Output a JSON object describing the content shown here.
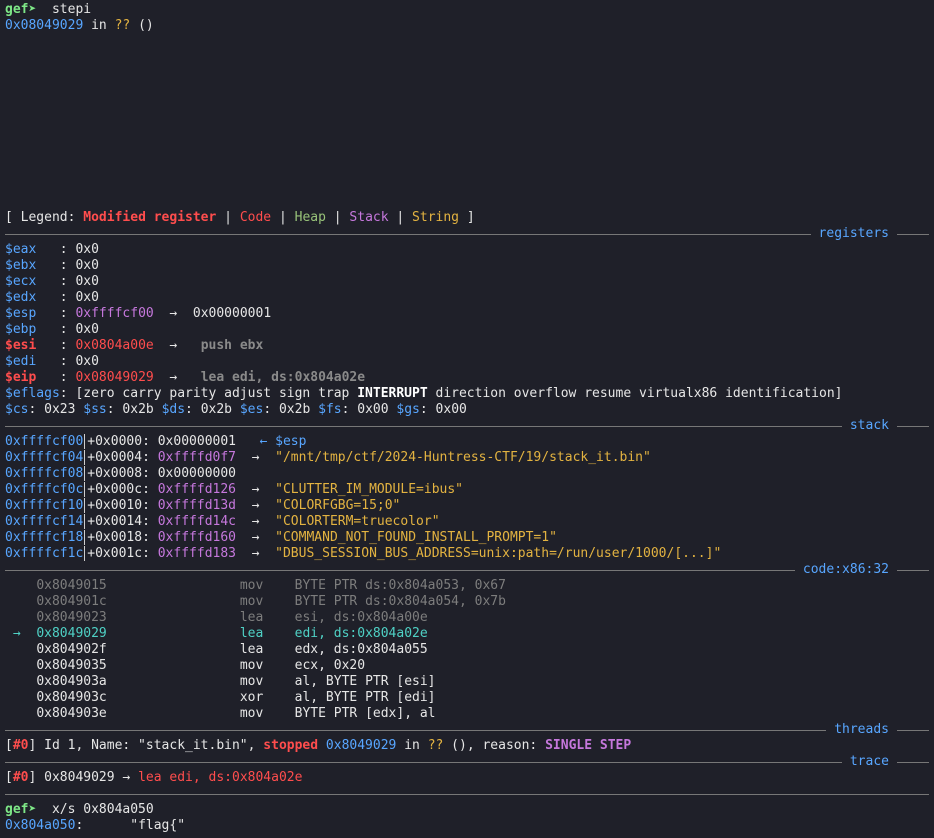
{
  "cmd1": {
    "prompt": "gef➤",
    "command": "stepi"
  },
  "loc": {
    "addr": "0x08049029",
    "in": "in",
    "fn": "??",
    "parens": "()"
  },
  "legend": {
    "open": "[ Legend: ",
    "modified": "Modified register",
    "sep": " | ",
    "code": "Code",
    "heap": "Heap",
    "stack": "Stack",
    "string": "String",
    "close": " ]"
  },
  "sections": {
    "registers": "registers",
    "stack": "stack",
    "code": "code:x86:32",
    "threads": "threads",
    "trace": "trace"
  },
  "registers": [
    {
      "name": "$eax",
      "sep": "   : ",
      "value": "0x0"
    },
    {
      "name": "$ebx",
      "sep": "   : ",
      "value": "0x0"
    },
    {
      "name": "$ecx",
      "sep": "   : ",
      "value": "0x0"
    },
    {
      "name": "$edx",
      "sep": "   : ",
      "value": "0x0"
    },
    {
      "name": "$esp",
      "sep": "   : ",
      "value": "0xffffcf00",
      "arrow": "  →  ",
      "target": "0x00000001"
    },
    {
      "name": "$ebp",
      "sep": "   : ",
      "value": "0x0"
    },
    {
      "name": "$esi",
      "sep": "   : ",
      "value": "0x0804a00e",
      "arrow": "  →  ",
      "target": " push ebx"
    },
    {
      "name": "$edi",
      "sep": "   : ",
      "value": "0x0"
    },
    {
      "name": "$eip",
      "sep": "   : ",
      "value": "0x08049029",
      "arrow": "  →  ",
      "target": " lea edi, ds:0x804a02e"
    }
  ],
  "eflags": {
    "name": "$eflags",
    "pre": ": [zero carry parity adjust sign trap ",
    "bold": "INTERRUPT",
    "post": " direction overflow resume virtualx86 identification]"
  },
  "segs": [
    {
      "name": "$cs",
      "value": ": 0x23 "
    },
    {
      "name": "$ss",
      "value": ": 0x2b "
    },
    {
      "name": "$ds",
      "value": ": 0x2b "
    },
    {
      "name": "$es",
      "value": ": 0x2b "
    },
    {
      "name": "$fs",
      "value": ": 0x00 "
    },
    {
      "name": "$gs",
      "value": ": 0x00"
    }
  ],
  "stack": [
    {
      "addr": "0xffffcf00",
      "off": "+0x0000: ",
      "val": "0x00000001",
      "arrow": "   ← ",
      "note": "$esp"
    },
    {
      "addr": "0xffffcf04",
      "off": "+0x0004: ",
      "val": "0xffffd0f7",
      "arrow": "  →  ",
      "note": "\"/mnt/tmp/ctf/2024-Huntress-CTF/19/stack_it.bin\""
    },
    {
      "addr": "0xffffcf08",
      "off": "+0x0008: ",
      "val": "0x00000000",
      "arrow": "",
      "note": ""
    },
    {
      "addr": "0xffffcf0c",
      "off": "+0x000c: ",
      "val": "0xffffd126",
      "arrow": "  →  ",
      "note": "\"CLUTTER_IM_MODULE=ibus\""
    },
    {
      "addr": "0xffffcf10",
      "off": "+0x0010: ",
      "val": "0xffffd13d",
      "arrow": "  →  ",
      "note": "\"COLORFGBG=15;0\""
    },
    {
      "addr": "0xffffcf14",
      "off": "+0x0014: ",
      "val": "0xffffd14c",
      "arrow": "  →  ",
      "note": "\"COLORTERM=truecolor\""
    },
    {
      "addr": "0xffffcf18",
      "off": "+0x0018: ",
      "val": "0xffffd160",
      "arrow": "  →  ",
      "note": "\"COMMAND_NOT_FOUND_INSTALL_PROMPT=1\""
    },
    {
      "addr": "0xffffcf1c",
      "off": "+0x001c: ",
      "val": "0xffffd183",
      "arrow": "  →  ",
      "note": "\"DBUS_SESSION_BUS_ADDRESS=unix:path=/run/user/1000/[...]\""
    }
  ],
  "code": [
    {
      "mark": "    ",
      "addr": "0x8049015",
      "op": "mov",
      "args": "BYTE PTR ds:0x804a053, 0x67",
      "state": "past"
    },
    {
      "mark": "    ",
      "addr": "0x804901c",
      "op": "mov",
      "args": "BYTE PTR ds:0x804a054, 0x7b",
      "state": "past"
    },
    {
      "mark": "    ",
      "addr": "0x8049023",
      "op": "lea",
      "args": "esi, ds:0x804a00e",
      "state": "past"
    },
    {
      "mark": " →  ",
      "addr": "0x8049029",
      "op": "lea",
      "args": "edi, ds:0x804a02e",
      "state": "current"
    },
    {
      "mark": "    ",
      "addr": "0x804902f",
      "op": "lea",
      "args": "edx, ds:0x804a055",
      "state": "next"
    },
    {
      "mark": "    ",
      "addr": "0x8049035",
      "op": "mov",
      "args": "ecx, 0x20",
      "state": "next"
    },
    {
      "mark": "    ",
      "addr": "0x804903a",
      "op": "mov",
      "args": "al, BYTE PTR [esi]",
      "state": "next"
    },
    {
      "mark": "    ",
      "addr": "0x804903c",
      "op": "xor",
      "args": "al, BYTE PTR [edi]",
      "state": "next"
    },
    {
      "mark": "    ",
      "addr": "0x804903e",
      "op": "mov",
      "args": "BYTE PTR [edx], al",
      "state": "next"
    }
  ],
  "thread": {
    "open": "[",
    "idx": "#0",
    "close": "] ",
    "text": "Id 1, Name: \"stack_it.bin\", ",
    "status": "stopped",
    "addr": "0x8049029",
    "in": " in ",
    "fn": "??",
    "mid": " (), reason: ",
    "reason": "SINGLE STEP"
  },
  "trace": {
    "open": "[",
    "idx": "#0",
    "close": "] ",
    "addr": "0x8049029",
    "arrow": " → ",
    "insn": "lea edi, ds:0x804a02e"
  },
  "cmd2": {
    "prompt": "gef➤",
    "command": "x/s 0x804a050"
  },
  "result": {
    "addr": "0x804a050",
    "colon": ":",
    "value": "\"flag{\""
  }
}
